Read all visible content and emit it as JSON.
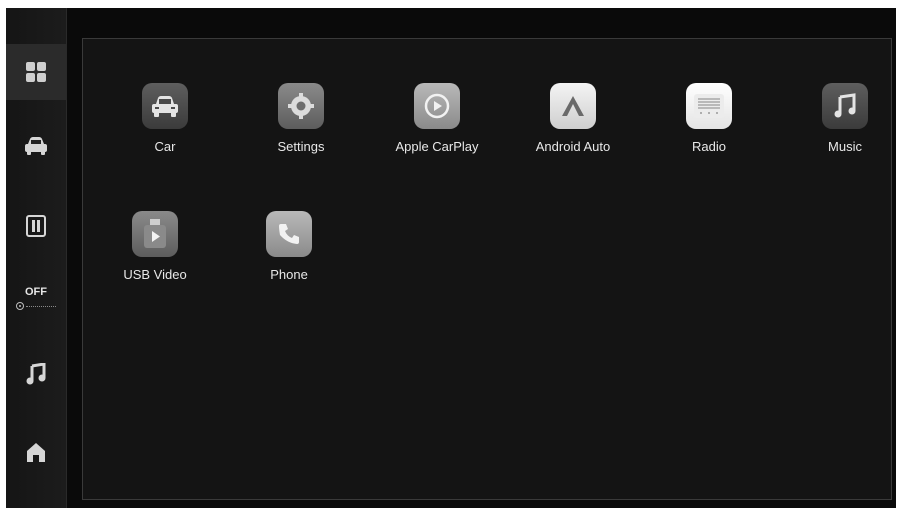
{
  "sidebar": {
    "climate": {
      "status": "OFF"
    }
  },
  "apps": [
    {
      "label": "Car",
      "icon": "car-icon"
    },
    {
      "label": "Settings",
      "icon": "gear-icon"
    },
    {
      "label": "Apple CarPlay",
      "icon": "carplay-icon"
    },
    {
      "label": "Android Auto",
      "icon": "android-auto-icon"
    },
    {
      "label": "Radio",
      "icon": "radio-icon"
    },
    {
      "label": "Music",
      "icon": "music-note-icon"
    },
    {
      "label": "USB Video",
      "icon": "usb-video-icon"
    },
    {
      "label": "Phone",
      "icon": "phone-icon"
    }
  ],
  "colors": {
    "background": "#0a0a0a",
    "panel": "#141414",
    "text": "#e8e8e8"
  }
}
